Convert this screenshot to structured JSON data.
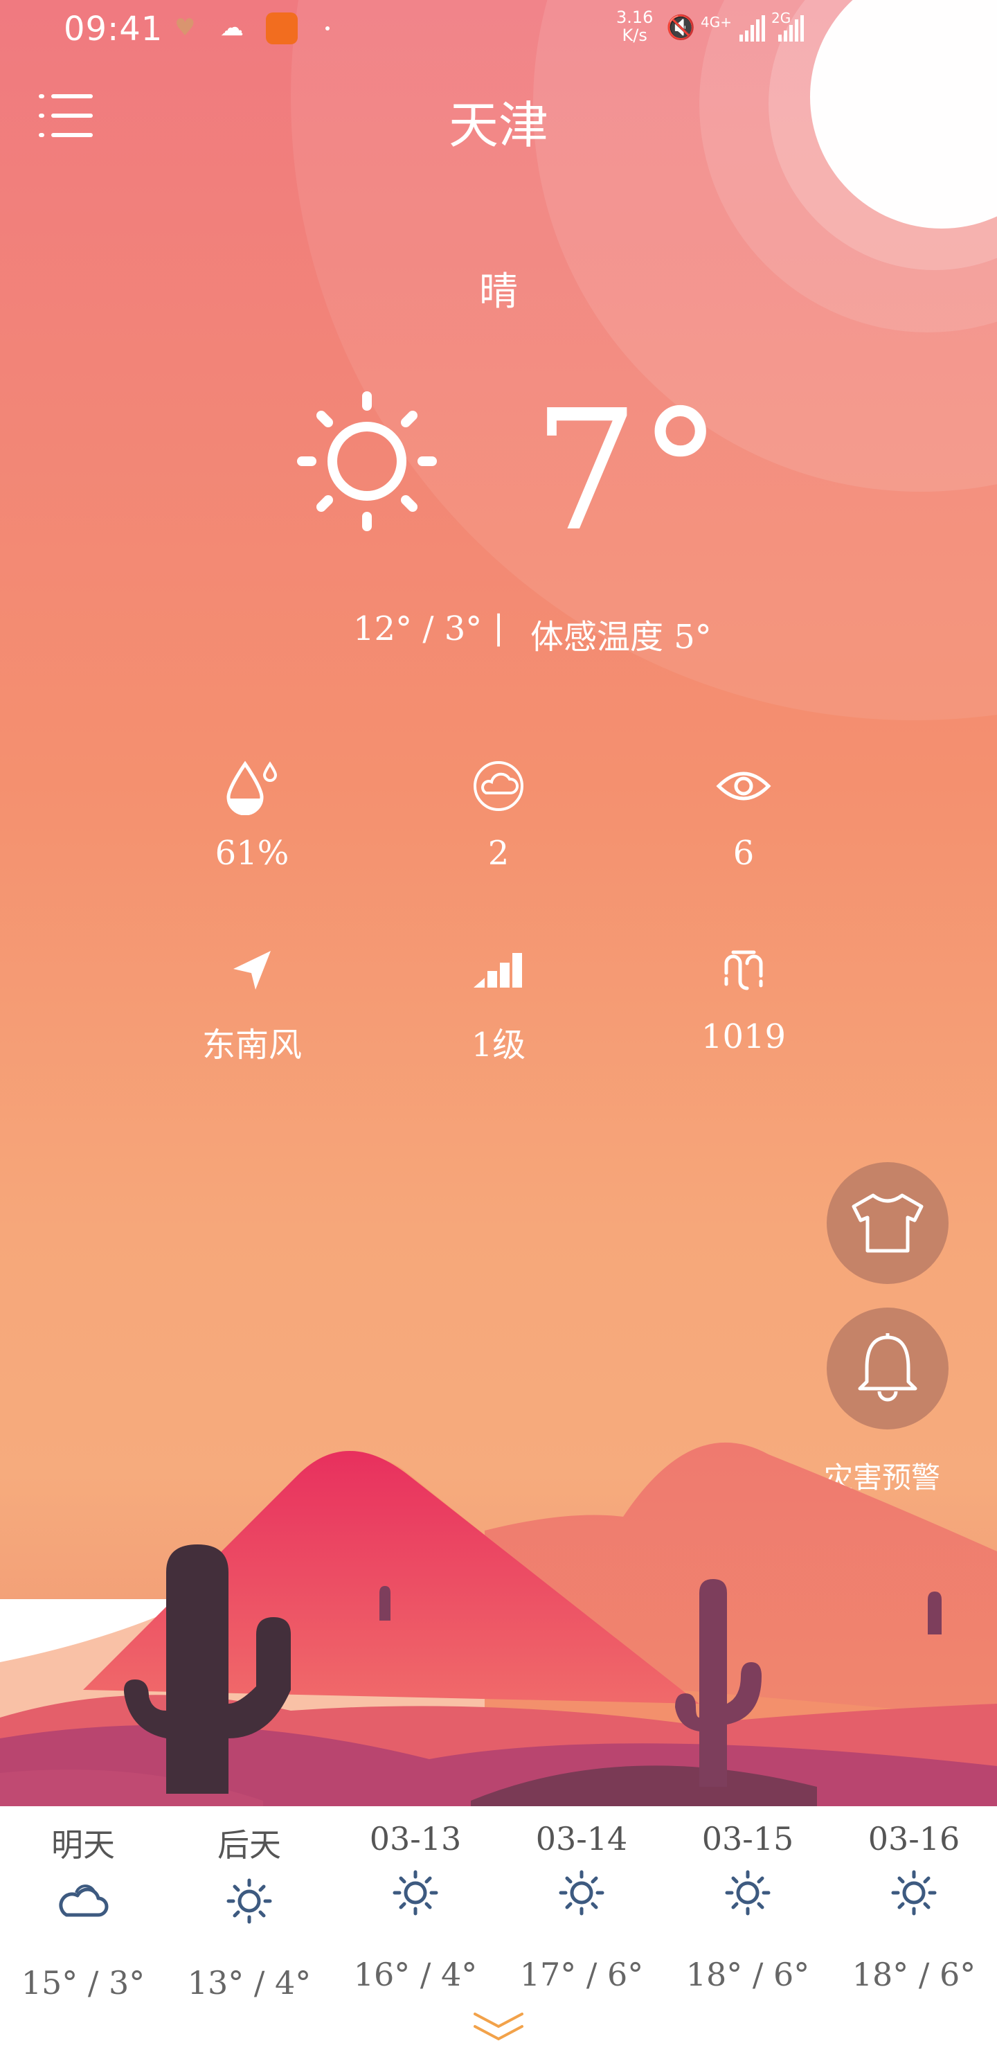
{
  "status_bar": {
    "time": "09:41",
    "net_speed_value": "3.16",
    "net_speed_unit": "K/s",
    "net_type_1": "4G+",
    "net_type_2": "2G",
    "icons": [
      "heart-rate-icon",
      "rain-cloud-icon",
      "uc-browser-icon",
      "mute-icon",
      "signal-icon",
      "signal-icon"
    ]
  },
  "header": {
    "city": "天津",
    "condition": "晴",
    "temperature": "7°",
    "range": "12° / 3°",
    "separator": "|",
    "feels_like": "体感温度 5°"
  },
  "metrics": [
    {
      "icon": "humidity-icon",
      "value": "61%"
    },
    {
      "icon": "air-quality-icon",
      "value": "2"
    },
    {
      "icon": "visibility-icon",
      "value": "6"
    },
    {
      "icon": "wind-direction-icon",
      "value": "东南风"
    },
    {
      "icon": "wind-level-icon",
      "value": "1级"
    },
    {
      "icon": "pressure-icon",
      "value": "1019"
    }
  ],
  "actions": {
    "disaster_label": "灾害预警"
  },
  "forecast": [
    {
      "day": "明天",
      "icon": "cloudy-icon",
      "range": "15° / 3°"
    },
    {
      "day": "后天",
      "icon": "sunny-icon",
      "range": "13° / 4°"
    },
    {
      "day": "03-13",
      "icon": "sunny-icon",
      "range": "16° / 4°"
    },
    {
      "day": "03-14",
      "icon": "sunny-icon",
      "range": "17° / 6°"
    },
    {
      "day": "03-15",
      "icon": "sunny-icon",
      "range": "18° / 6°"
    },
    {
      "day": "03-16",
      "icon": "sunny-icon",
      "range": "18° / 6°"
    }
  ],
  "colors": {
    "sky_top": "#f07a80",
    "sky_bottom": "#f6ab7d",
    "mountain": "#e8305e",
    "cactus": "#432f3b",
    "fab": "#c58368",
    "forecast_icon": "#3d5a80"
  }
}
